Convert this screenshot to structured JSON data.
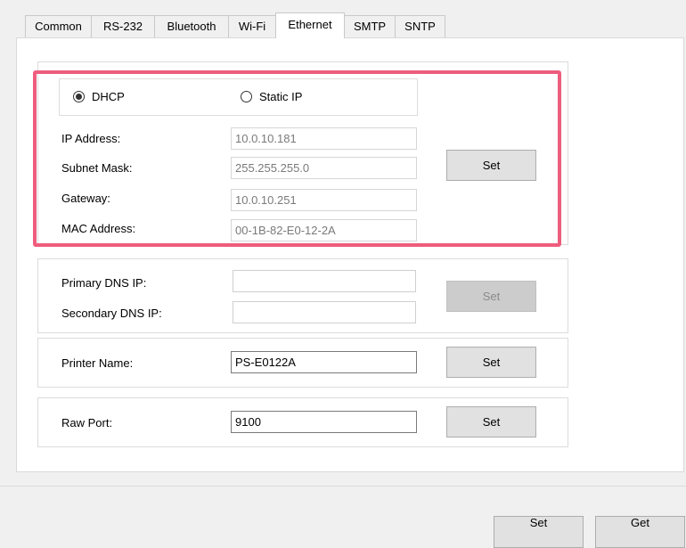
{
  "tabs": [
    {
      "label": "Common"
    },
    {
      "label": "RS-232"
    },
    {
      "label": "Bluetooth"
    },
    {
      "label": "Wi-Fi"
    },
    {
      "label": "Ethernet"
    },
    {
      "label": "SMTP"
    },
    {
      "label": "SNTP"
    }
  ],
  "active_tab": "Ethernet",
  "ip_section": {
    "mode_selected": "DHCP",
    "dhcp_label": "DHCP",
    "static_label": "Static IP",
    "ip_address_label": "IP Address:",
    "ip_address_value": "10.0.10.181",
    "subnet_mask_label": "Subnet Mask:",
    "subnet_mask_value": "255.255.255.0",
    "gateway_label": "Gateway:",
    "gateway_value": "10.0.10.251",
    "mac_address_label": "MAC Address:",
    "mac_address_value": "00-1B-82-E0-12-2A",
    "set_label": "Set"
  },
  "dns_section": {
    "primary_label": "Primary DNS IP:",
    "primary_value": "",
    "secondary_label": "Secondary DNS IP:",
    "secondary_value": "",
    "set_label": "Set"
  },
  "printer_name_section": {
    "label": "Printer Name:",
    "value": "PS-E0122A",
    "set_label": "Set"
  },
  "raw_port_section": {
    "label": "Raw Port:",
    "value": "9100",
    "set_label": "Set"
  },
  "footer": {
    "set_label": "Set",
    "get_label": "Get"
  },
  "colors": {
    "highlight": "#ee5d7d",
    "disabled_button": "#cccccc"
  }
}
